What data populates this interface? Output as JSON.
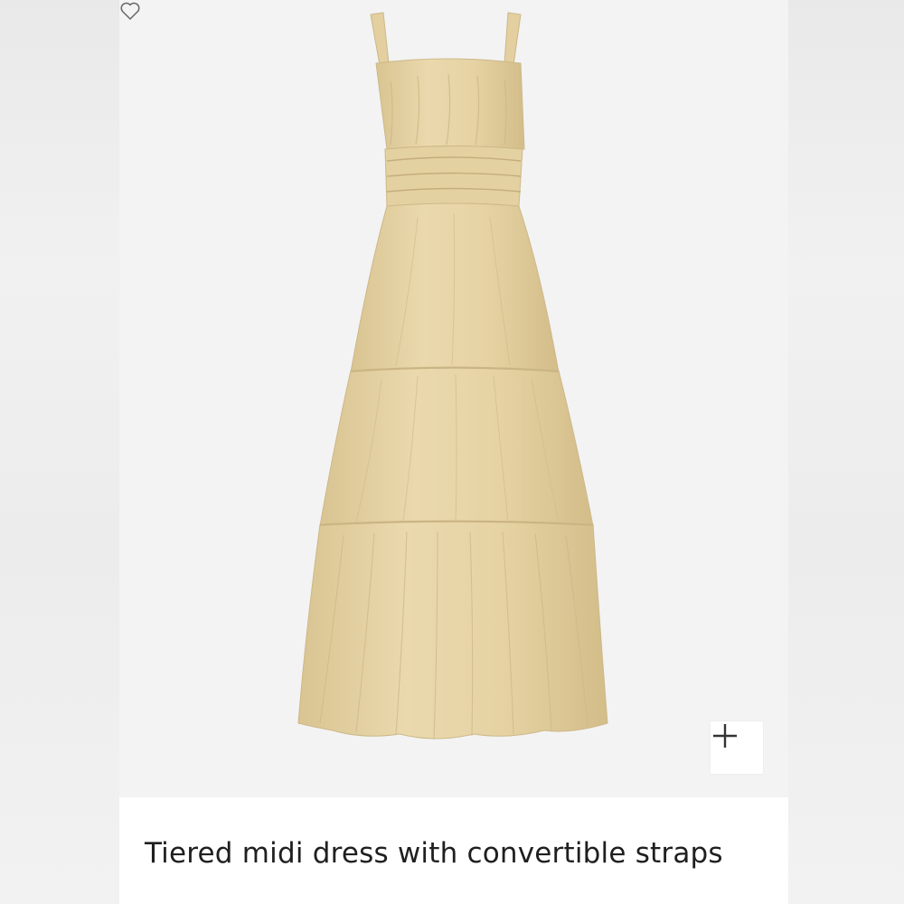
{
  "product": {
    "title": "Tiered midi dress with convertible straps",
    "image_subject": "dress-photo",
    "colors": {
      "fabric": "#e6d3a4",
      "fabric_shadow": "#cdb888",
      "fabric_highlight": "#efe1b9",
      "background": "#f3f3f3",
      "caption_bg": "#ffffff",
      "text": "#1f1f1f"
    }
  },
  "controls": {
    "zoom_icon": "plus-icon",
    "favorite_icon": "heart-icon"
  }
}
